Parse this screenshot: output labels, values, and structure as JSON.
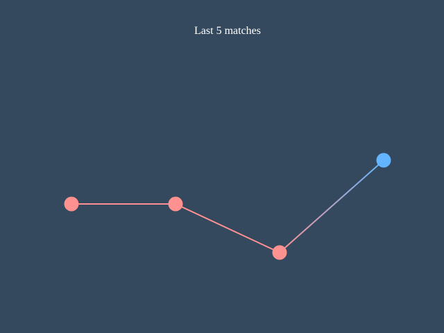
{
  "chart_data": {
    "type": "line",
    "title": "Last 5 matches",
    "xlabel": "",
    "ylabel": "",
    "x": [
      1,
      2,
      3,
      4
    ],
    "values": [
      0,
      0,
      -1,
      1
    ],
    "ylim": [
      -2,
      2
    ],
    "grid": false,
    "legend": "none",
    "colors": {
      "background": "#34495e",
      "loss": "#ff9191",
      "win": "#64b5ff",
      "title": "#ffffff"
    }
  }
}
